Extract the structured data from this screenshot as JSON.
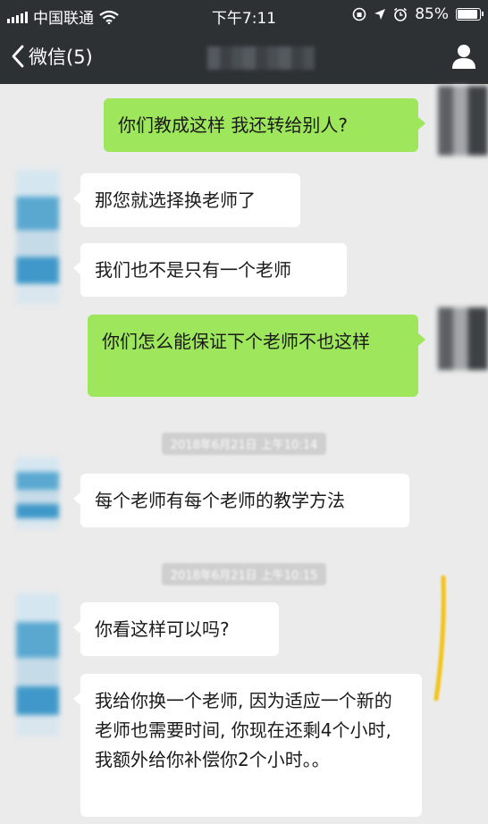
{
  "status_bar": {
    "carrier": "中国联通",
    "time": "下午7:11",
    "battery_percent": "85%",
    "battery_level": 0.85
  },
  "nav": {
    "back_label": "微信(5)"
  },
  "messages": [
    {
      "side": "out",
      "text": "你们教成这样 我还转给别人?"
    },
    {
      "side": "in",
      "text": "那您就选择换老师了"
    },
    {
      "side": "in",
      "text": "我们也不是只有一个老师"
    },
    {
      "side": "out",
      "text": "你们怎么能保证下个老师不也这样"
    },
    {
      "side": "time",
      "text": "2018年6月21日 上午10:14"
    },
    {
      "side": "in",
      "text": "每个老师有每个老师的教学方法"
    },
    {
      "side": "time",
      "text": "2018年6月21日 上午10:15"
    },
    {
      "side": "in",
      "text": "你看这样可以吗?"
    },
    {
      "side": "in",
      "text": "我给你换一个老师, 因为适应一个新的老师也需要时间, 你现在还剩4个小时, 我额外给你补偿你2个小时。。"
    }
  ],
  "colors": {
    "bar": "#2e3134",
    "chat_bg": "#ebebeb",
    "out_bubble": "#9ee65b",
    "in_bubble": "#ffffff"
  }
}
